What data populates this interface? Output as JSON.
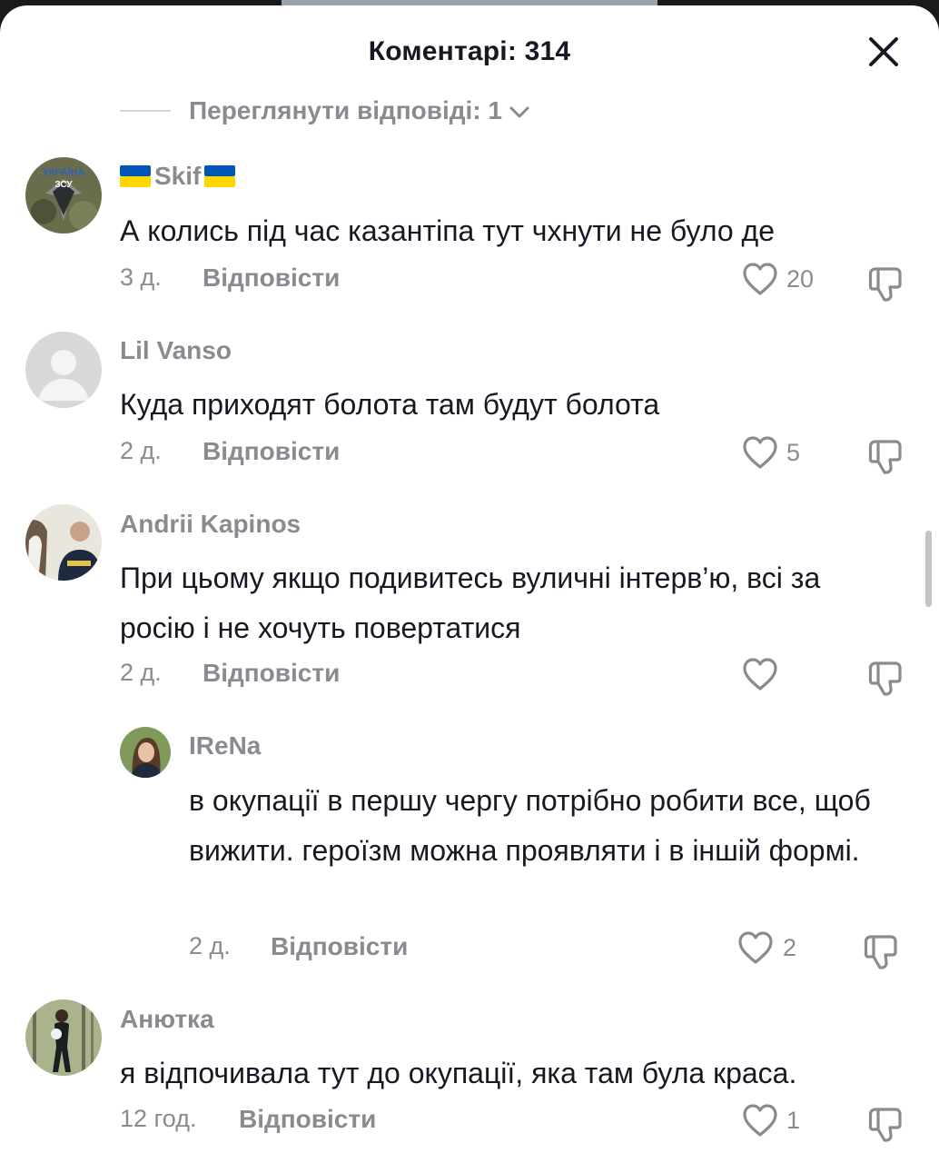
{
  "header": {
    "title": "Коментарі: 314"
  },
  "view_replies": {
    "label": "Переглянути відповіді: 1"
  },
  "reply_label": "Відповісти",
  "comments": [
    {
      "username": "Skif",
      "flag": "🇺🇦",
      "text": "А колись під час казантіпа тут чхнути не було де",
      "time": "3 д.",
      "likes": "20",
      "avatar_text_top": "УКРАЇНА",
      "avatar_text_mid": "ЗСУ"
    },
    {
      "username": "Lil Vanso",
      "text": "Куда приходят болота там будут болота",
      "time": "2 д.",
      "likes": "5"
    },
    {
      "username": "Andrii Kapinos",
      "text": "При цьому якщо подивитесь вуличні інтерв’ю, всі за росію і не хочуть повертатися",
      "time": "2 д.",
      "likes": ""
    },
    {
      "username": "IReNa",
      "text": "в окупації в першу чергу потрібно робити все, щоб вижити. героїзм можна проявляти і в іншій формі.",
      "time": "2 д.",
      "likes": "2"
    },
    {
      "username": "Анютка",
      "text": "я відпочивала тут до окупації, яка там була краса.",
      "time": "12 год.",
      "likes": "1"
    }
  ],
  "colors": {
    "secondary_text": "#8a8b91",
    "primary_text": "#161823",
    "flag_blue": "#0057B7",
    "flag_yellow": "#FFD700"
  }
}
